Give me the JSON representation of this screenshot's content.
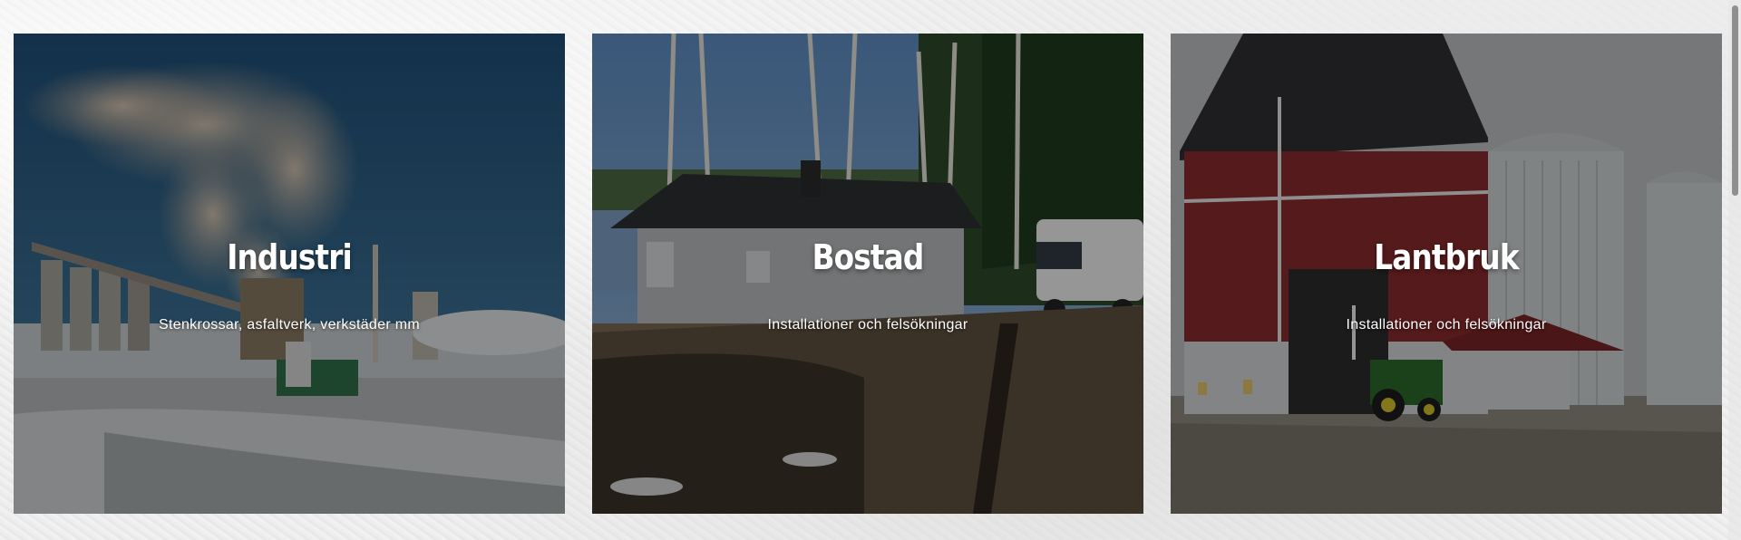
{
  "cards": [
    {
      "title": "Industri",
      "subtitle": "Stenkrossar, asfaltverk, verkstäder mm",
      "image": "industrial-plant-photo"
    },
    {
      "title": "Bostad",
      "subtitle": "Installationer och felsökningar",
      "image": "house-with-van-photo"
    },
    {
      "title": "Lantbruk",
      "subtitle": "Installationer och felsökningar",
      "image": "farm-silo-photo"
    }
  ],
  "colors": {
    "overlay": "#000000",
    "text": "#ffffff",
    "page_background": "#eeeeee"
  }
}
